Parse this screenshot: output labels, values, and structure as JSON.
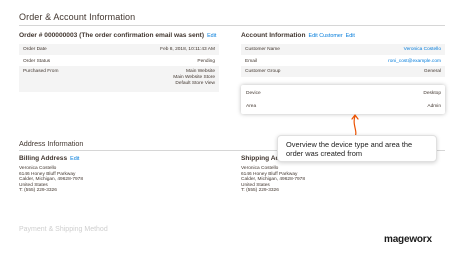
{
  "section": {
    "title": "Order & Account Information"
  },
  "order": {
    "heading": "Order # 000000003 (The order confirmation email was sent)",
    "edit": "Edit",
    "rows": [
      {
        "label": "Order Date",
        "value": "Feb 8, 2018, 10:11:43 AM"
      },
      {
        "label": "Order Status",
        "value": "Pending"
      },
      {
        "label": "Purchased From",
        "value_lines": [
          "Main Website",
          "Main Website Store",
          "Default Store View"
        ]
      }
    ]
  },
  "account": {
    "heading": "Account Information",
    "edit": "Edit Customer",
    "edit2": "Edit",
    "rows": [
      {
        "label": "Customer Name",
        "value": "Veronica Costello"
      },
      {
        "label": "Email",
        "value": "roni_cost@example.com"
      },
      {
        "label": "Customer Group",
        "value": "General"
      }
    ],
    "highlight": [
      {
        "label": "Device",
        "value": "Desktop"
      },
      {
        "label": "Area",
        "value": "Admin"
      }
    ]
  },
  "address": {
    "title": "Address Information",
    "billing": {
      "heading": "Billing Address",
      "edit": "Edit",
      "lines": [
        "Veronica Costello",
        "6146 Honey Bluff Parkway",
        "Calder, Michigan, 49628-7978",
        "United States",
        "T: (555) 229-3326"
      ]
    },
    "shipping": {
      "heading": "Shipping Ad",
      "lines": [
        "Veronica Costello",
        "6146 Honey Bluff Parkway",
        "Calder, Michigan, 49628-7978",
        "United States",
        "T: (555) 229-3326"
      ]
    }
  },
  "payment": {
    "title": "Payment & Shipping Method"
  },
  "callout": {
    "text": "Overview the device type and area the order was created from"
  },
  "brand": {
    "logo": "mageworx"
  },
  "colors": {
    "link": "#007bdb",
    "arrow": "#eb5202",
    "text": "#41362f"
  }
}
